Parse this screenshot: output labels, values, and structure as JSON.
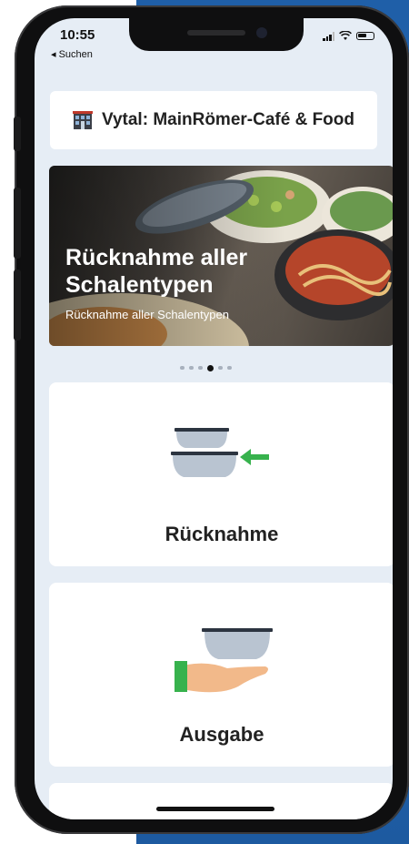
{
  "status_bar": {
    "time": "10:55",
    "back_label": "◂ Suchen"
  },
  "header": {
    "title": "Vytal: MainRömer-Café & Food",
    "icon": "store-icon"
  },
  "banner": {
    "headline": "Rücknahme aller Schalentypen",
    "subtitle": "Rücknahme aller Schalentypen",
    "slides_total": 6,
    "active_slide": 4
  },
  "actions": [
    {
      "label": "Rücknahme",
      "icon": "bowl-return-icon"
    },
    {
      "label": "Ausgabe",
      "icon": "bowl-handout-icon"
    }
  ],
  "colors": {
    "accent_blue": "#2467b3",
    "arrow_green": "#37b24d",
    "screen_bg": "#e6edf5"
  }
}
